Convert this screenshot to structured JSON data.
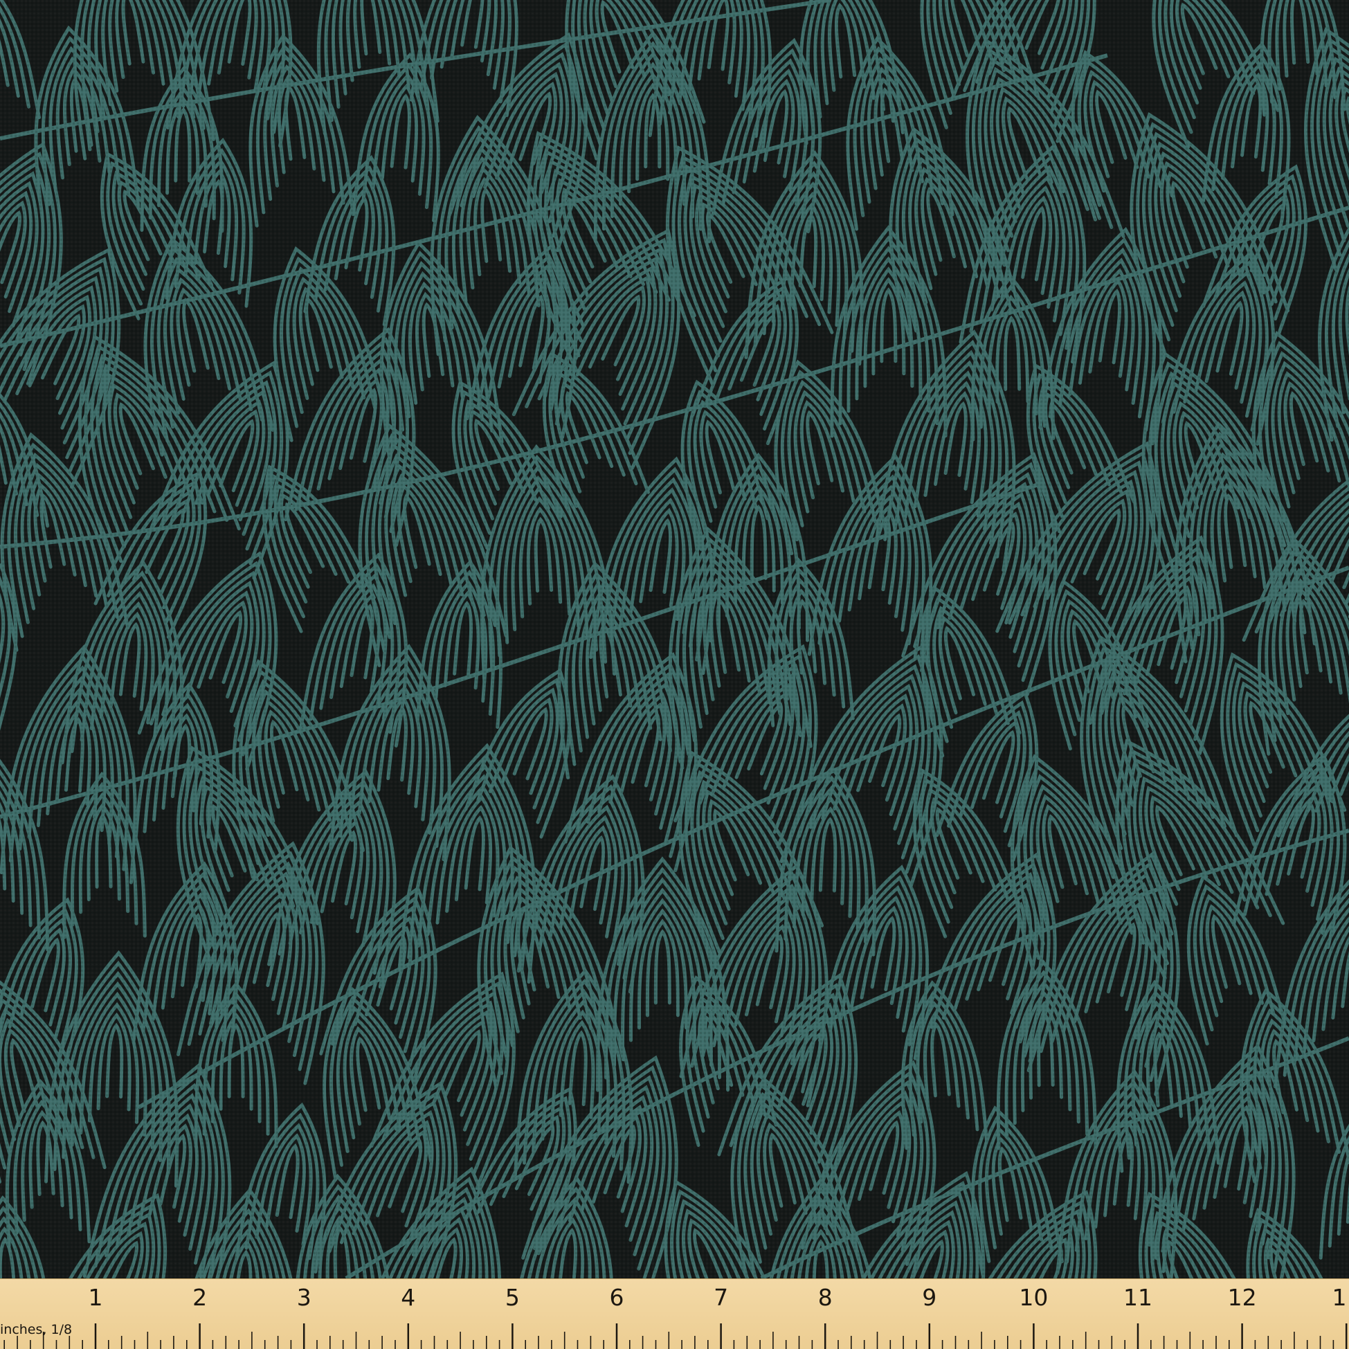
{
  "fabric": {
    "pattern_name": "swirl-line-pattern",
    "background_color": "#151918",
    "line_color": "#3f6e6a"
  },
  "ruler": {
    "unit_label": "inches, 1/8",
    "numbers": [
      "1",
      "2",
      "3",
      "4",
      "5",
      "6",
      "7",
      "8",
      "9",
      "10",
      "11",
      "12",
      "1"
    ],
    "background_color": "#f0d49c",
    "text_color": "#1c1710"
  }
}
